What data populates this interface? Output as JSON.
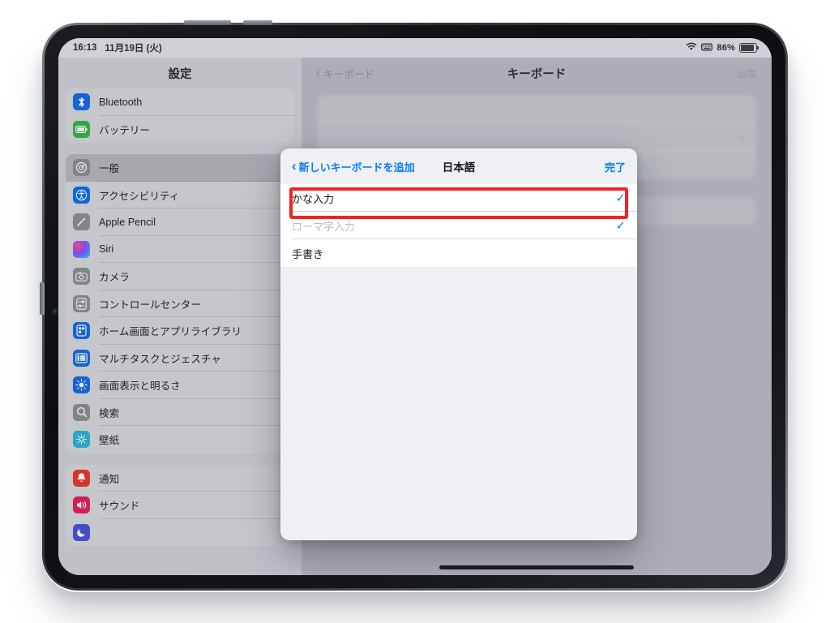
{
  "status_bar": {
    "time": "16:13",
    "date": "11月19日 (火)",
    "wifi_icon": "wifi-icon",
    "keyboard_icon": "keyboard-icon",
    "battery_percent": "86%",
    "battery_icon": "battery-icon"
  },
  "sidebar": {
    "title": "設定",
    "groups": [
      {
        "items": [
          {
            "label": "Bluetooth",
            "icon": "bluetooth-icon",
            "icon_class": "bluetooth",
            "glyph": "✺",
            "selected": false
          },
          {
            "label": "バッテリー",
            "icon": "battery-icon",
            "icon_class": "battery-ic",
            "glyph": "▭",
            "selected": false
          }
        ]
      },
      {
        "items": [
          {
            "label": "一般",
            "icon": "gear-icon",
            "icon_class": "general",
            "glyph": "⚙",
            "selected": true
          },
          {
            "label": "アクセシビリティ",
            "icon": "accessibility-icon",
            "icon_class": "access",
            "glyph": "♿",
            "selected": false
          },
          {
            "label": "Apple Pencil",
            "icon": "pencil-icon",
            "icon_class": "pencil",
            "glyph": "✎",
            "selected": false
          },
          {
            "label": "Siri",
            "icon": "siri-icon",
            "icon_class": "siri",
            "glyph": "",
            "selected": false
          },
          {
            "label": "カメラ",
            "icon": "camera-icon",
            "icon_class": "camera-ic",
            "glyph": "◎",
            "selected": false
          },
          {
            "label": "コントロールセンター",
            "icon": "control-center-icon",
            "icon_class": "control",
            "glyph": "⦿",
            "selected": false
          },
          {
            "label": "ホーム画面とアプリライブラリ",
            "icon": "home-screen-icon",
            "icon_class": "home",
            "glyph": "▣",
            "selected": false
          },
          {
            "label": "マルチタスクとジェスチャ",
            "icon": "multitasking-icon",
            "icon_class": "multitask",
            "glyph": "▢",
            "selected": false
          },
          {
            "label": "画面表示と明るさ",
            "icon": "brightness-icon",
            "icon_class": "display",
            "glyph": "☀",
            "selected": false
          },
          {
            "label": "検索",
            "icon": "search-icon",
            "icon_class": "search-ic",
            "glyph": "⌕",
            "selected": false
          },
          {
            "label": "壁紙",
            "icon": "wallpaper-icon",
            "icon_class": "wallpaper",
            "glyph": "❁",
            "selected": false
          }
        ]
      },
      {
        "items": [
          {
            "label": "通知",
            "icon": "notification-bell-icon",
            "icon_class": "notify",
            "glyph": "🔔",
            "selected": false
          },
          {
            "label": "サウンド",
            "icon": "sound-icon",
            "icon_class": "sound",
            "glyph": "🔊",
            "selected": false
          },
          {
            "label": "",
            "icon": "focus-icon",
            "icon_class": "focus",
            "glyph": "☾",
            "selected": false
          }
        ]
      }
    ]
  },
  "detail": {
    "back_label": "キーボード",
    "title": "キーボード",
    "edit_label": "編集",
    "back_chevron": "chevron-left-icon",
    "row_chevron": "chevron-right-icon"
  },
  "modal": {
    "back_label": "新しいキーボードを追加",
    "back_chevron": "chevron-left-icon",
    "title": "日本語",
    "done_label": "完了",
    "rows": [
      {
        "label": "かな入力",
        "checked": true,
        "dimmed": false,
        "highlighted": true
      },
      {
        "label": "ローマ字入力",
        "checked": true,
        "dimmed": true,
        "highlighted": false
      },
      {
        "label": "手書き",
        "checked": false,
        "dimmed": false,
        "highlighted": false
      }
    ],
    "check_glyph": "✓",
    "highlight_color": "#f02323"
  },
  "colors": {
    "accent_blue": "#0a7bff",
    "annotation_red": "#f02323",
    "sidebar_bg": "#cfd1d6",
    "detail_bg": "#babcc2",
    "modal_bg": "#eef0f4"
  }
}
